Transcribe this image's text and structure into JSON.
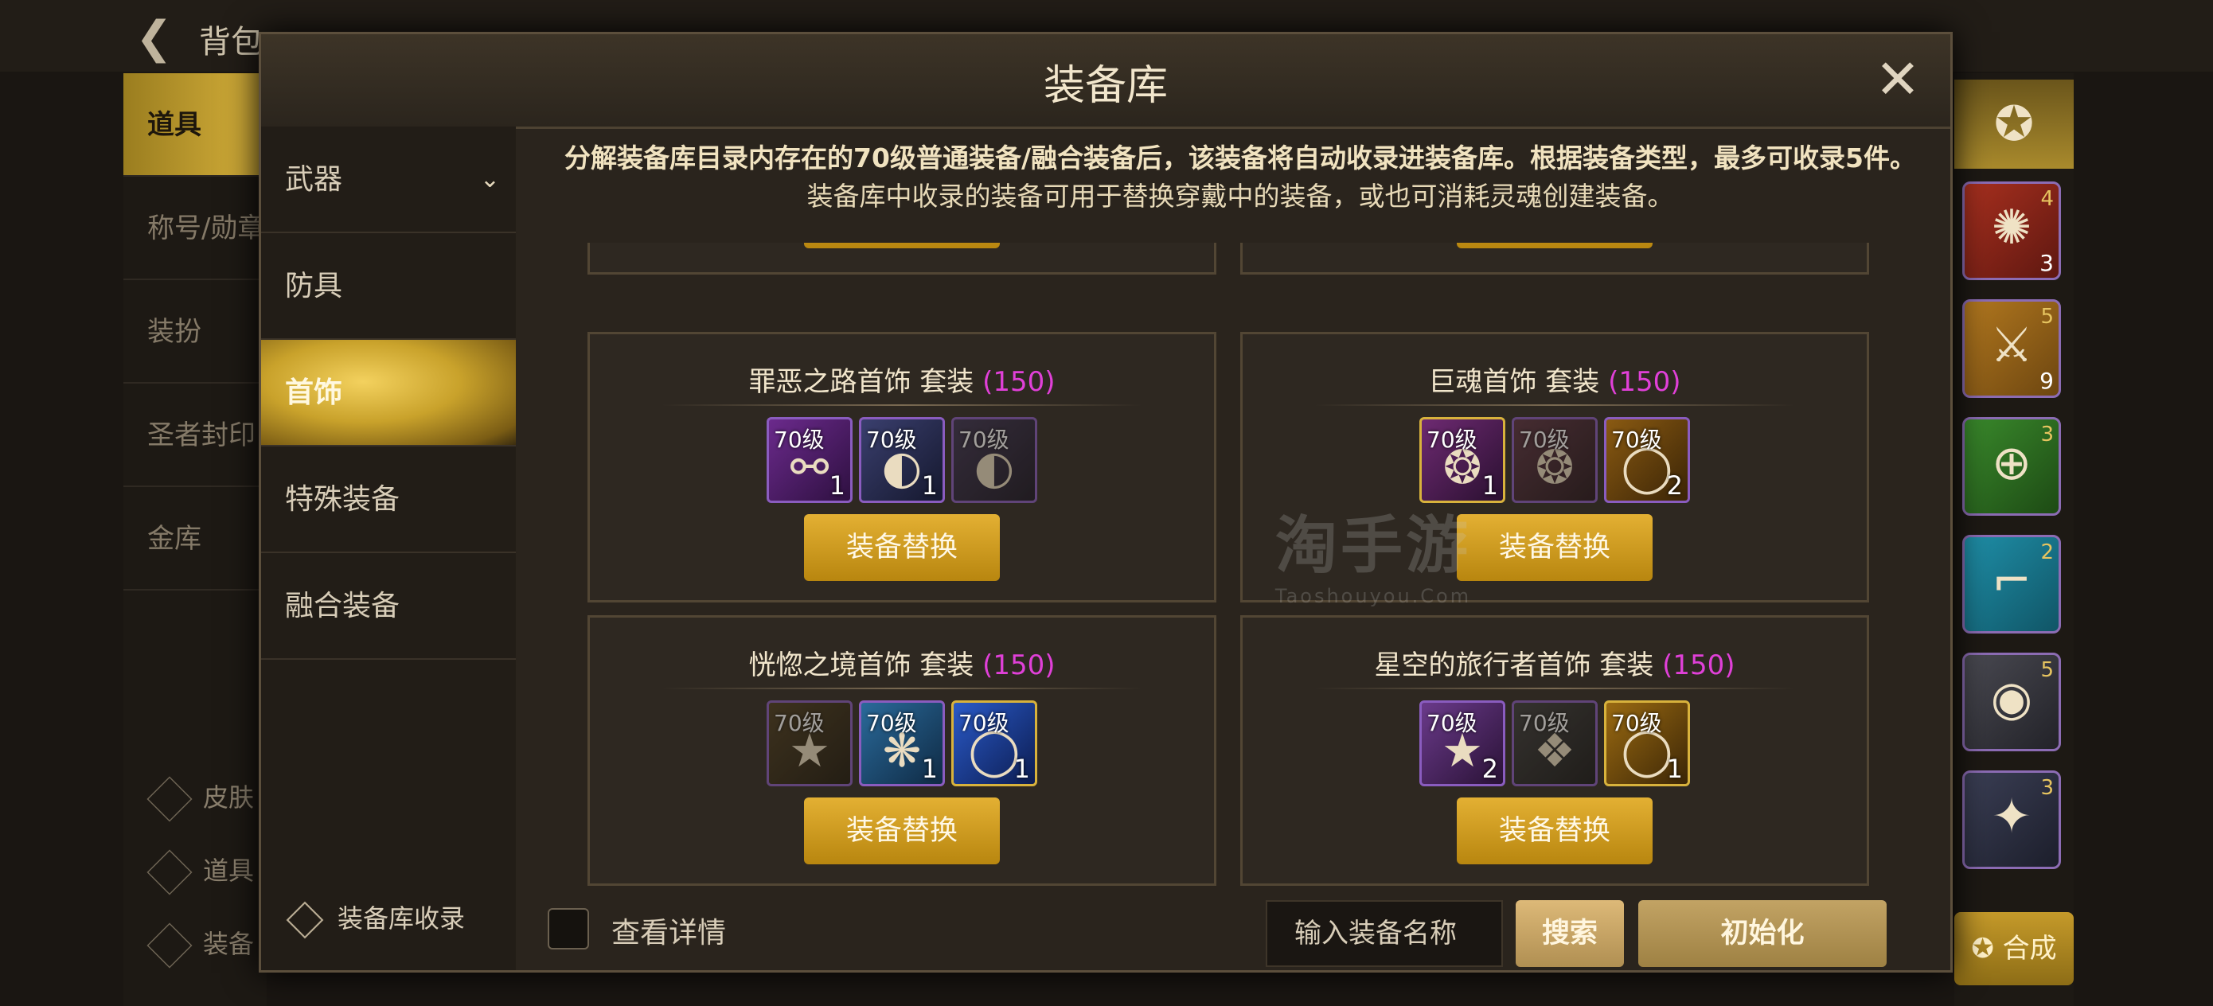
{
  "background": {
    "back_icon": "back-arrow-icon",
    "title": "背包",
    "left_tabs": [
      "道具",
      "称号/勋章",
      "装扮",
      "圣者封印",
      "金库"
    ],
    "tools": [
      "皮肤",
      "道具",
      "装备"
    ],
    "right_slots": [
      {
        "icon": "figure-icon",
        "rank": "4",
        "count": "3"
      },
      {
        "icon": "sword-icon",
        "rank": "5",
        "count": "9"
      },
      {
        "icon": "target-icon",
        "rank": "3",
        "count": ""
      },
      {
        "icon": "boot-icon",
        "rank": "2",
        "count": ""
      },
      {
        "icon": "arm-icon",
        "rank": "5",
        "count": ""
      },
      {
        "icon": "star-icon",
        "rank": "3",
        "count": ""
      }
    ],
    "merge_label": "合成"
  },
  "modal": {
    "title": "装备库",
    "close_icon": "close-icon",
    "categories": [
      {
        "label": "武器",
        "expanded": true
      },
      {
        "label": "防具"
      },
      {
        "label": "首饰",
        "selected": true
      },
      {
        "label": "特殊装备"
      },
      {
        "label": "融合装备"
      }
    ],
    "collect_label": "装备库收录",
    "notice_line1": "分解装备库目录内存在的70级普通装备/融合装备后，该装备将自动收录进装备库。根据装备类型，最多可收录5件。",
    "notice_line2": "装备库中收录的装备可用于替换穿戴中的装备，或也可消耗灵魂创建装备。",
    "swap_label": "装备替换",
    "sets": [
      {
        "name": "罪恶之路首饰  套装 ",
        "level": "(150)",
        "items": [
          {
            "level": "70级",
            "count": "1",
            "icon": "chain-icon",
            "owned": true,
            "rarity": "epic"
          },
          {
            "level": "70级",
            "count": "1",
            "icon": "bracelet-icon",
            "owned": true,
            "rarity": "epic"
          },
          {
            "level": "70级",
            "count": "",
            "icon": "bracelet-icon",
            "owned": false,
            "rarity": "epic"
          }
        ]
      },
      {
        "name": "巨魂首饰  套装 ",
        "level": "(150)",
        "items": [
          {
            "level": "70级",
            "count": "1",
            "icon": "amulet-icon",
            "owned": true,
            "rarity": "legendary"
          },
          {
            "level": "70级",
            "count": "",
            "icon": "amulet-icon",
            "owned": false,
            "rarity": "epic"
          },
          {
            "level": "70级",
            "count": "2",
            "icon": "ring-icon",
            "owned": true,
            "rarity": "epic"
          }
        ]
      },
      {
        "name": "恍惚之境首饰  套装 ",
        "level": "(150)",
        "items": [
          {
            "level": "70级",
            "count": "",
            "icon": "star-pendant-icon",
            "owned": false,
            "rarity": "epic"
          },
          {
            "level": "70级",
            "count": "1",
            "icon": "gem-icon",
            "owned": true,
            "rarity": "epic"
          },
          {
            "level": "70级",
            "count": "1",
            "icon": "ring-icon",
            "owned": true,
            "rarity": "legendary"
          }
        ]
      },
      {
        "name": "星空的旅行者首饰  套装 ",
        "level": "(150)",
        "items": [
          {
            "level": "70级",
            "count": "2",
            "icon": "star-pendant-icon",
            "owned": true,
            "rarity": "epic"
          },
          {
            "level": "70级",
            "count": "",
            "icon": "gem-icon",
            "owned": false,
            "rarity": "epic"
          },
          {
            "level": "70级",
            "count": "1",
            "icon": "ring-icon",
            "owned": true,
            "rarity": "legendary"
          }
        ]
      }
    ],
    "view_details_label": "查看详情",
    "search_placeholder": "输入装备名称",
    "search_label": "搜索",
    "reset_label": "初始化"
  },
  "watermark": {
    "line1": "淘手游",
    "line2": "Taoshouyou.Com"
  }
}
